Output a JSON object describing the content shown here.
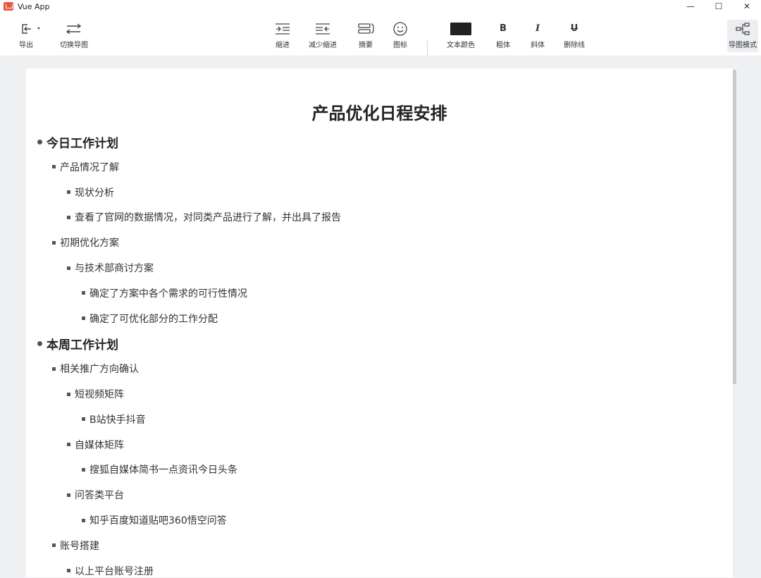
{
  "window": {
    "title": "Vue App",
    "controls": {
      "minimize": "—",
      "maximize": "☐",
      "close": "✕"
    }
  },
  "toolbar": {
    "export": {
      "label": "导出",
      "icon": "export-icon"
    },
    "switch_map": {
      "label": "切换导图",
      "icon": "swap-icon"
    },
    "indent": {
      "label": "缩进",
      "icon": "indent-icon"
    },
    "outdent": {
      "label": "减少缩进",
      "icon": "outdent-icon"
    },
    "summary": {
      "label": "摘要",
      "icon": "summary-icon"
    },
    "icon_btn": {
      "label": "图标",
      "icon": "smiley-icon"
    },
    "text_color": {
      "label": "文本颜色",
      "color": "#222222"
    },
    "bold": {
      "label": "粗体",
      "glyph": "B"
    },
    "italic": {
      "label": "斜体",
      "glyph": "I"
    },
    "strike": {
      "label": "删除线",
      "glyph": "U"
    },
    "mind_map_mode": {
      "label": "导图模式",
      "icon": "mindmap-icon"
    }
  },
  "document": {
    "title": "产品优化日程安排",
    "nodes": [
      {
        "level": 1,
        "text": "今日工作计划"
      },
      {
        "level": 2,
        "text": "产品情况了解"
      },
      {
        "level": 3,
        "text": "现状分析"
      },
      {
        "level": 3,
        "text": "查看了官网的数据情况，对同类产品进行了解，并出具了报告"
      },
      {
        "level": 2,
        "text": "初期优化方案"
      },
      {
        "level": 3,
        "text": "与技术部商讨方案"
      },
      {
        "level": 4,
        "text": "确定了方案中各个需求的可行性情况"
      },
      {
        "level": 4,
        "text": "确定了可优化部分的工作分配"
      },
      {
        "level": 1,
        "text": "本周工作计划"
      },
      {
        "level": 2,
        "text": "相关推广方向确认"
      },
      {
        "level": 3,
        "text": "短视频矩阵"
      },
      {
        "level": 4,
        "text": "B站快手抖音"
      },
      {
        "level": 3,
        "text": "自媒体矩阵"
      },
      {
        "level": 4,
        "text": "搜狐自媒体简书一点资讯今日头条"
      },
      {
        "level": 3,
        "text": "问答类平台"
      },
      {
        "level": 4,
        "text": "知乎百度知道贴吧360悟空问答"
      },
      {
        "level": 2,
        "text": "账号搭建"
      },
      {
        "level": 3,
        "text": "以上平台账号注册"
      }
    ]
  }
}
